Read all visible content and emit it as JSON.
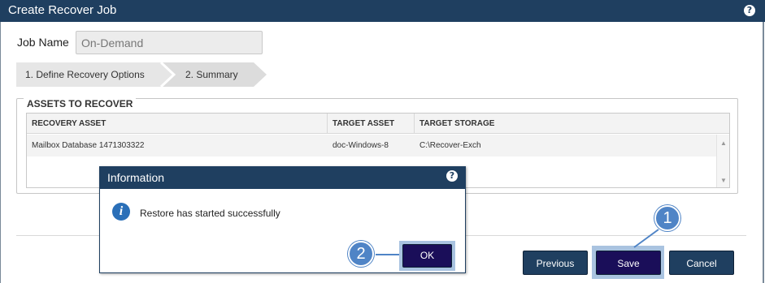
{
  "window": {
    "title": "Create Recover Job",
    "help_icon": "?"
  },
  "job": {
    "label": "Job Name",
    "value": "On-Demand"
  },
  "steps": [
    {
      "label": "1. Define Recovery Options"
    },
    {
      "label": "2. Summary"
    }
  ],
  "assets": {
    "legend": "ASSETS TO RECOVER",
    "columns": [
      "RECOVERY ASSET",
      "TARGET ASSET",
      "TARGET STORAGE"
    ],
    "rows": [
      [
        "Mailbox Database 1471303322",
        "doc-Windows-8",
        "C:\\Recover-Exch"
      ]
    ]
  },
  "buttons": {
    "previous": "Previous",
    "save": "Save",
    "cancel": "Cancel"
  },
  "dialog": {
    "title": "Information",
    "help_icon": "?",
    "info_icon": "i",
    "message": "Restore has started successfully",
    "ok": "OK"
  },
  "callouts": [
    "1",
    "2"
  ],
  "colors": {
    "header": "#1f3f60",
    "primary_button": "#1a0e59",
    "callout": "#4f84c6",
    "highlight": "#a9c3e0"
  }
}
